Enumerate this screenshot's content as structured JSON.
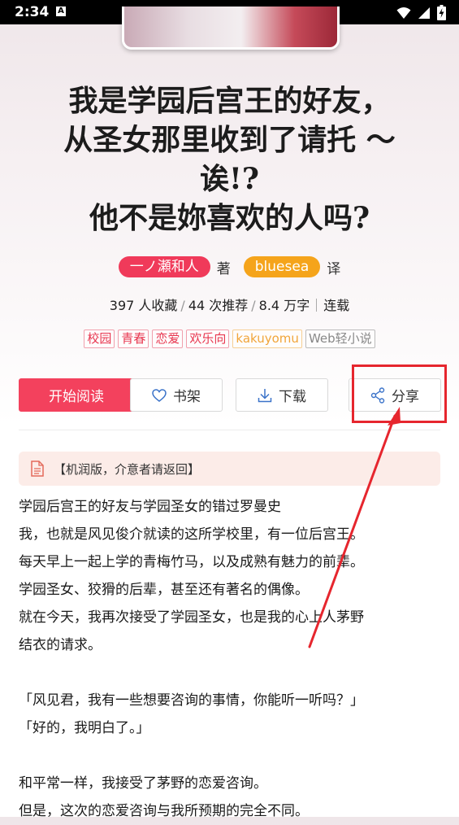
{
  "status_bar": {
    "time": "2:34",
    "app_icon_letter": "A"
  },
  "book": {
    "title_lines": [
      "我是学园后宫王的好友，",
      "从圣女那里收到了请托 ～",
      "诶!?",
      "他不是妳喜欢的人吗?"
    ],
    "author": "一ノ瀬和人",
    "author_role": "著",
    "translator": "bluesea",
    "translator_role": "译",
    "stats": {
      "favorites": "397 人收藏",
      "recommendations": "44 次推荐",
      "words": "8.4 万字",
      "status": "连载"
    },
    "tags": [
      {
        "label": "校园",
        "color": "red"
      },
      {
        "label": "青春",
        "color": "red"
      },
      {
        "label": "恋爱",
        "color": "red"
      },
      {
        "label": "欢乐向",
        "color": "red"
      },
      {
        "label": "kakuyomu",
        "color": "orange"
      },
      {
        "label": "Web轻小说",
        "color": "gray"
      }
    ]
  },
  "actions": {
    "read_label": "开始阅读",
    "shelf_label": "书架",
    "download_label": "下载",
    "share_label": "分享"
  },
  "notice": {
    "text": "【机润版，介意者请返回】"
  },
  "description": [
    "学园后宫王的好友与学园圣女的错过罗曼史",
    "我，也就是风见俊介就读的这所学校里，有一位后宫王。",
    "每天早上一起上学的青梅竹马，以及成熟有魅力的前辈。",
    "学园圣女、狡猾的后辈，甚至还有著名的偶像。",
    "就在今天，我再次接受了学园圣女，也是我的心上人茅野",
    "结衣的请求。",
    "",
    "「风见君，我有一些想要咨询的事情，你能听一听吗？」",
    "「好的，我明白了。」",
    "",
    "和平常一样，我接受了茅野的恋爱咨询。",
    "但是，这次的恋爱咨询与我所预期的完全不同。"
  ],
  "colors": {
    "accent": "#f3415d",
    "annotation": "#e6262e",
    "translator": "#f5a41b"
  },
  "icons": {
    "shelf": "heart-icon",
    "download": "download-icon",
    "share": "share-icon",
    "notice": "document-icon"
  }
}
